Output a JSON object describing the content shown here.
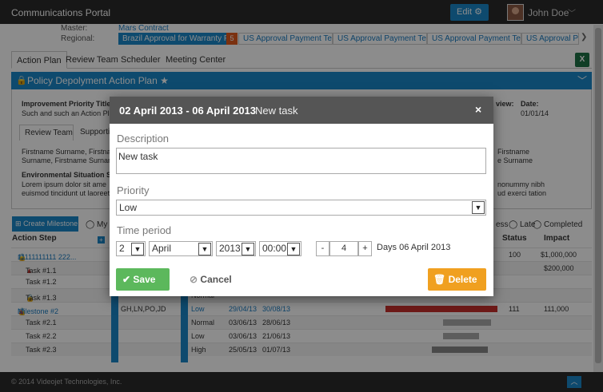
{
  "app": {
    "title": "Communications Portal",
    "edit_label": "Edit",
    "user_name": "John Doe"
  },
  "header": {
    "master_label": "Master:",
    "master_value": "Mars Contract",
    "regional_label": "Regional:",
    "regional_selected": "Brazil Approval for Warranty First",
    "badge_count": "5",
    "regional_tabs": [
      "US Approval Payment Terms",
      "US Approval Payment Terms",
      "US Approval Payment Terms",
      "US Approval Payment Terms"
    ]
  },
  "tabs": [
    "Action Plan",
    "Review Team",
    "Scheduler",
    "Meeting Center"
  ],
  "excel_label": "X",
  "panel": {
    "title": "Policy Depolyment Action Plan",
    "priority_title": "Improvement Priority Title:",
    "priority_text": "Such and such an Action Plan",
    "review_label": "view:",
    "date_label": "Date:",
    "date_value": "01/01/14",
    "subtab_review": "Review Team",
    "subtab_support": "Supporti",
    "names_left_1": "Firstname Surname, Firstnam",
    "names_left_2": "Surname, Firstname Surnam",
    "names_right_1": "Firstname",
    "names_right_2": "e Surname",
    "env_title": "Environmental Situation Su",
    "env_text_1": "Lorem ipsum dolor sit ame",
    "env_text_2": "euismod tincidunt ut laoreet",
    "env_right_1": "nonummy nibh",
    "env_right_2": "ud exerci tation"
  },
  "milestone_btn": "Create Milestone",
  "filters": {
    "my": "My C",
    "progress": "ess",
    "late": "Late",
    "completed": "Completed"
  },
  "table": {
    "headers": {
      "step": "Action Step",
      "status": "Status",
      "impact": "Impact"
    },
    "rows": [
      {
        "name": "11111111111 222...",
        "priority": "",
        "start": "",
        "end": "",
        "status": "100",
        "impact": "$1,000,000"
      },
      {
        "name": "Task #1.1",
        "priority": "",
        "start": "",
        "end": "",
        "status": "",
        "impact": "$200,000"
      },
      {
        "name": "Task #1.2",
        "priority": "",
        "start": "",
        "end": "",
        "status": "",
        "impact": ""
      },
      {
        "name": "Task #1.3",
        "priority": "Normal",
        "start": "",
        "end": "",
        "status": "",
        "impact": ""
      },
      {
        "name": "Milestone #2",
        "owners": "GH,LN,PO,JD",
        "priority": "Low",
        "start": "29/04/13",
        "end": "30/08/13",
        "status": "111",
        "impact": "111,000"
      },
      {
        "name": "Task #2.1",
        "priority": "Normal",
        "start": "03/06/13",
        "end": "28/06/13",
        "status": "",
        "impact": ""
      },
      {
        "name": "Task #2.2",
        "priority": "Low",
        "start": "03/06/13",
        "end": "21/06/13",
        "status": "",
        "impact": ""
      },
      {
        "name": "Task #2.3",
        "priority": "High",
        "start": "25/05/13",
        "end": "01/07/13",
        "status": "",
        "impact": ""
      }
    ]
  },
  "footer": "© 2014 Videojet Technologies, Inc.",
  "modal": {
    "dates": "02 April 2013 - 06 April 2013",
    "task": "New task",
    "close": "×",
    "description_label": "Description",
    "description_value": "New task",
    "priority_label": "Priority",
    "priority_value": "Low",
    "period_label": "Time period",
    "day": "2",
    "month": "April",
    "year": "2013",
    "time": "00:00",
    "minus": "-",
    "count": "4",
    "plus": "+",
    "days_text": "Days 06 April 2013",
    "save": "Save",
    "cancel": "Cancel",
    "delete": "Delete"
  },
  "colors": {
    "accent": "#1a88c9",
    "save": "#5cb85c",
    "delete": "#f0a020",
    "topbar": "#2b2b2b",
    "bar_red": "#c9302c",
    "bar_grey": "#999999"
  }
}
